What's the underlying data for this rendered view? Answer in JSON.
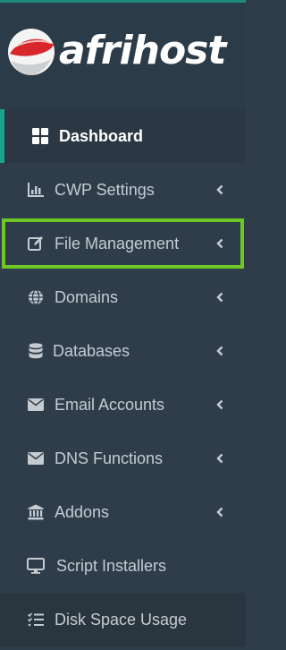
{
  "brand": {
    "name": "afrihost",
    "colors": {
      "accent": "#1ba38f",
      "highlight": "#6cc727",
      "logo_red": "#d7262c",
      "sidebar_bg": "#2f3d4b"
    }
  },
  "menu": {
    "items": [
      {
        "label": "Dashboard",
        "icon": "dashboard-grid-icon",
        "active": true,
        "has_submenu": false
      },
      {
        "label": "CWP Settings",
        "icon": "bar-chart-icon",
        "active": false,
        "has_submenu": true
      },
      {
        "label": "File Management",
        "icon": "edit-icon",
        "active": false,
        "has_submenu": true,
        "highlighted": true
      },
      {
        "label": "Domains",
        "icon": "globe-icon",
        "active": false,
        "has_submenu": true
      },
      {
        "label": "Databases",
        "icon": "database-icon",
        "active": false,
        "has_submenu": true
      },
      {
        "label": "Email Accounts",
        "icon": "envelope-icon",
        "active": false,
        "has_submenu": true
      },
      {
        "label": "DNS Functions",
        "icon": "envelope-icon",
        "active": false,
        "has_submenu": true
      },
      {
        "label": "Addons",
        "icon": "bank-icon",
        "active": false,
        "has_submenu": true
      },
      {
        "label": "Script Installers",
        "icon": "monitor-icon",
        "active": false,
        "has_submenu": false
      },
      {
        "label": "Disk Space Usage",
        "icon": "list-check-icon",
        "active": false,
        "has_submenu": false
      }
    ]
  }
}
